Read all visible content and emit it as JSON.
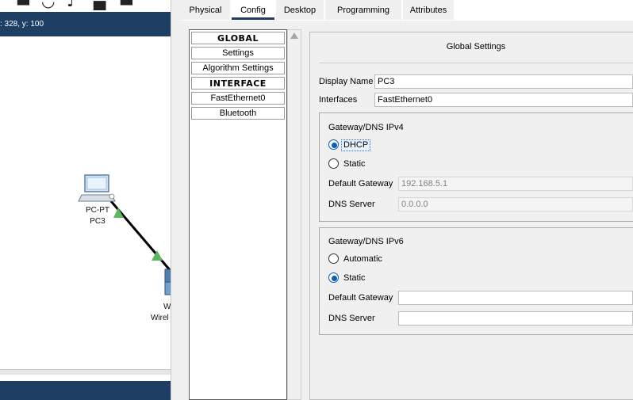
{
  "workspace": {
    "coords_text": ": 328, y: 100",
    "device_pc": {
      "type_label": "PC-PT",
      "name_label": "PC3"
    },
    "device_wireless": {
      "line1": "W",
      "line2": "Wirel"
    }
  },
  "dialog": {
    "tabs": [
      {
        "label": "Physical"
      },
      {
        "label": "Config"
      },
      {
        "label": "Desktop"
      },
      {
        "label": "Programming"
      },
      {
        "label": "Attributes"
      }
    ],
    "active_tab": "Config",
    "nav": {
      "global_header": "GLOBAL",
      "items_global": [
        "Settings",
        "Algorithm Settings"
      ],
      "interface_header": "INTERFACE",
      "items_interface": [
        "FastEthernet0",
        "Bluetooth"
      ]
    },
    "panel": {
      "title": "Global Settings",
      "display_name_label": "Display Name",
      "display_name_value": "PC3",
      "interfaces_label": "Interfaces",
      "interfaces_value": "FastEthernet0",
      "ipv4": {
        "title": "Gateway/DNS IPv4",
        "dhcp_label": "DHCP",
        "static_label": "Static",
        "selected": "DHCP",
        "gateway_label": "Default Gateway",
        "gateway_value": "192.168.5.1",
        "dns_label": "DNS Server",
        "dns_value": "0.0.0.0"
      },
      "ipv6": {
        "title": "Gateway/DNS IPv6",
        "automatic_label": "Automatic",
        "static_label": "Static",
        "selected": "Static",
        "gateway_label": "Default Gateway",
        "gateway_value": "",
        "dns_label": "DNS Server",
        "dns_value": ""
      }
    }
  },
  "colors": {
    "navy": "#1f3e64",
    "radio_selected": "#0a5fb4",
    "link_arrow": "#5cb85c"
  }
}
